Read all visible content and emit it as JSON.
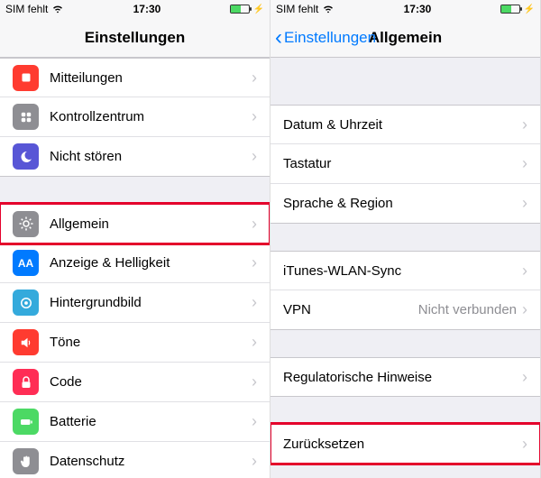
{
  "statusbar": {
    "carrier": "SIM fehlt",
    "time": "17:30"
  },
  "left_screen": {
    "nav_title": "Einstellungen",
    "groups": [
      {
        "items": [
          {
            "key": "notifications",
            "label": "Mitteilungen",
            "icon": "notifications-icon",
            "icon_bg": "bg-red"
          },
          {
            "key": "control_center",
            "label": "Kontrollzentrum",
            "icon": "control-center-icon",
            "icon_bg": "bg-gray"
          },
          {
            "key": "do_not_disturb",
            "label": "Nicht stören",
            "icon": "moon-icon",
            "icon_bg": "bg-purple"
          }
        ]
      },
      {
        "items": [
          {
            "key": "general",
            "label": "Allgemein",
            "icon": "gear-icon",
            "icon_bg": "bg-gray",
            "highlight": true
          },
          {
            "key": "display",
            "label": "Anzeige & Helligkeit",
            "icon": "display-icon",
            "icon_bg": "bg-blue"
          },
          {
            "key": "wallpaper",
            "label": "Hintergrundbild",
            "icon": "wallpaper-icon",
            "icon_bg": "bg-cyan"
          },
          {
            "key": "sounds",
            "label": "Töne",
            "icon": "speaker-icon",
            "icon_bg": "bg-red"
          },
          {
            "key": "passcode",
            "label": "Code",
            "icon": "lock-icon",
            "icon_bg": "bg-pink"
          },
          {
            "key": "battery",
            "label": "Batterie",
            "icon": "battery-icon",
            "icon_bg": "bg-green"
          },
          {
            "key": "privacy",
            "label": "Datenschutz",
            "icon": "hand-icon",
            "icon_bg": "bg-gray"
          }
        ]
      }
    ]
  },
  "right_screen": {
    "nav_back": "Einstellungen",
    "nav_title": "Allgemein",
    "groups": [
      {
        "spacer_before": 52,
        "items": [
          {
            "key": "date_time",
            "label": "Datum & Uhrzeit"
          },
          {
            "key": "keyboard",
            "label": "Tastatur"
          },
          {
            "key": "language_region",
            "label": "Sprache & Region"
          }
        ]
      },
      {
        "spacer_before": 30,
        "items": [
          {
            "key": "itunes_wlan_sync",
            "label": "iTunes-WLAN-Sync"
          },
          {
            "key": "vpn",
            "label": "VPN",
            "value": "Nicht verbunden"
          }
        ]
      },
      {
        "spacer_before": 30,
        "items": [
          {
            "key": "regulatory",
            "label": "Regulatorische Hinweise"
          }
        ]
      },
      {
        "spacer_before": 30,
        "items": [
          {
            "key": "reset",
            "label": "Zurücksetzen",
            "highlight": true
          }
        ]
      }
    ]
  }
}
